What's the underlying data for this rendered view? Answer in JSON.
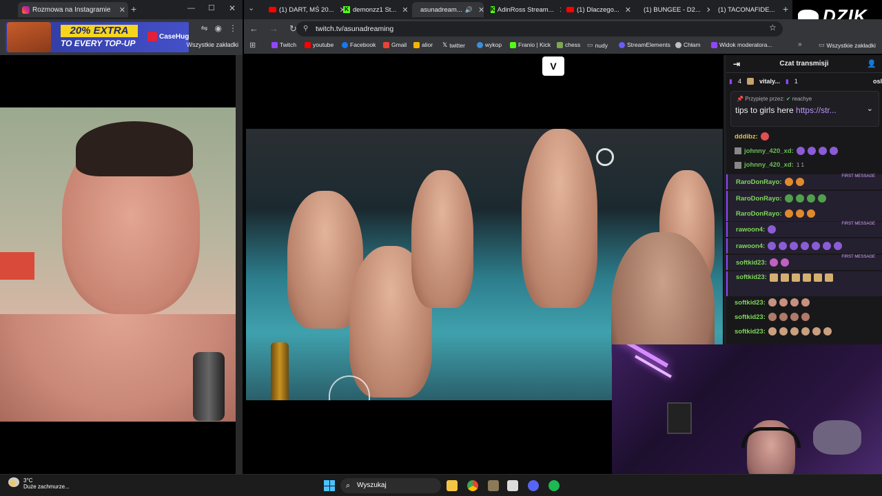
{
  "left_window": {
    "tab_title": "Rozmowa na Instagramie",
    "ad": {
      "headline": "20% EXTRA",
      "subline": "TO EVERY TOP-UP",
      "brand": "CaseHug"
    },
    "bookmarks_label": "Wszystkie zakładki"
  },
  "right_window": {
    "tabs": [
      {
        "label": "(1) DART, MŚ 20..."
      },
      {
        "label": "demonzz1 St..."
      },
      {
        "label": "asunadream..."
      },
      {
        "label": "AdinRoss Stream..."
      },
      {
        "label": "(1) Dlaczego..."
      },
      {
        "label": "(1) BUNGEE - D2..."
      },
      {
        "label": "(1) TACONAFIDE..."
      }
    ],
    "url": "twitch.tv/asunadreaming",
    "bookmarks": [
      {
        "label": "Twitch",
        "color": "#9146ff"
      },
      {
        "label": "youtube",
        "color": "#ff0000"
      },
      {
        "label": "Facebook",
        "color": "#1877f2"
      },
      {
        "label": "Gmail",
        "color": "#ea4335"
      },
      {
        "label": "alior",
        "color": "#f4b400"
      },
      {
        "label": "twitter",
        "color": "#ffffff"
      },
      {
        "label": "wykop",
        "color": "#3b8ee0"
      },
      {
        "label": "Franio | Kick",
        "color": "#53fc18"
      },
      {
        "label": "chess",
        "color": "#7fa650"
      },
      {
        "label": "nudy",
        "color": "#bdc1c6"
      },
      {
        "label": "StreamElements",
        "color": "#6b5cff"
      },
      {
        "label": "Chłam",
        "color": "#bdc1c6"
      },
      {
        "label": "Widok moderatora...",
        "color": "#9146ff"
      }
    ],
    "bookmarks_all": "Wszystkie zakładki"
  },
  "player": {
    "logo_text": "V"
  },
  "chat": {
    "title": "Czat transmisji",
    "gift_summary": {
      "count_a": "4",
      "user": "vitaly...",
      "count_b": "1",
      "trailing": "osl"
    },
    "pinned": {
      "by_label": "Przypięte przez:",
      "by_user": "reachye",
      "message": "tips to girls here ",
      "link": "https://str..."
    },
    "messages": [
      {
        "user": "dddibz:",
        "color": "#e8c04a",
        "text": "",
        "first": false
      },
      {
        "user": "johnny_420_xd:",
        "color": "#6bbd55",
        "text": "",
        "first": false
      },
      {
        "user": "johnny_420_xd:",
        "color": "#6bbd55",
        "text": "1   1",
        "first": false
      },
      {
        "user": "RaroDonRayo:",
        "color": "#7ed957",
        "text": "",
        "first": true
      },
      {
        "user": "RaroDonRayo:",
        "color": "#7ed957",
        "text": "",
        "first": false
      },
      {
        "user": "RaroDonRayo:",
        "color": "#7ed957",
        "text": "",
        "first": false
      },
      {
        "user": "rawoon4:",
        "color": "#7ed957",
        "text": "",
        "first": true
      },
      {
        "user": "rawoon4:",
        "color": "#7ed957",
        "text": "",
        "first": false
      },
      {
        "user": "softkid23:",
        "color": "#7ed957",
        "text": "",
        "first": true
      },
      {
        "user": "softkid23:",
        "color": "#7ed957",
        "text": "",
        "first": false
      },
      {
        "user": "softkid23:",
        "color": "#7ed957",
        "text": "",
        "first": false
      },
      {
        "user": "softkid23:",
        "color": "#7ed957",
        "text": "",
        "first": false
      },
      {
        "user": "softkid23:",
        "color": "#7ed957",
        "text": "",
        "first": false
      }
    ],
    "first_message_tag": "FIRST MESSAGE"
  },
  "overlay": {
    "brand": "DZIK"
  },
  "taskbar": {
    "weather_temp": "3°C",
    "weather_desc": "Duże zachmurze...",
    "search_placeholder": "Wyszukaj"
  }
}
